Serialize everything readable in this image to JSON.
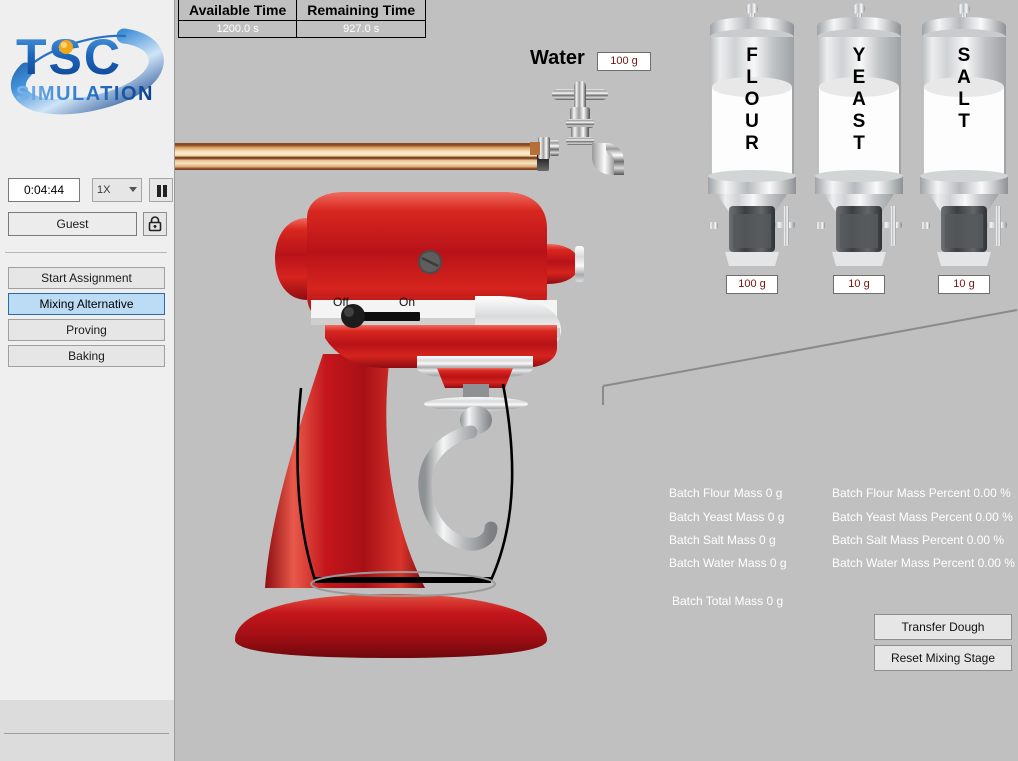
{
  "app": {
    "logo_main": "TSC",
    "logo_sub": "SIMULATION"
  },
  "sidebar": {
    "time_display": "0:04:44",
    "speed": "1X",
    "speed_options": [
      "1X"
    ],
    "pause_icon": "pause-icon",
    "user": "Guest",
    "lock_icon": "lock-icon",
    "nav": [
      {
        "label": "Start Assignment",
        "active": false
      },
      {
        "label": "Mixing Alternative",
        "active": true
      },
      {
        "label": "Proving",
        "active": false
      },
      {
        "label": "Baking",
        "active": false
      }
    ]
  },
  "time_table": {
    "headers": [
      "Available Time",
      "Remaining Time"
    ],
    "values": [
      "1200.0 s",
      "927.0 s"
    ]
  },
  "water": {
    "label": "Water",
    "value": "100 g",
    "faucet_icon": "faucet-icon",
    "pipe_icon": "copper-pipe"
  },
  "dispensers": [
    {
      "name": "FLOUR",
      "letters": [
        "F",
        "L",
        "O",
        "U",
        "R"
      ],
      "value": "100 g"
    },
    {
      "name": "YEAST",
      "letters": [
        "Y",
        "E",
        "A",
        "S",
        "T"
      ],
      "value": "10 g"
    },
    {
      "name": "SALT",
      "letters": [
        "S",
        "A",
        "L",
        "T"
      ],
      "value": "10 g"
    }
  ],
  "mixer": {
    "switch_off": "Off",
    "switch_on": "On",
    "switch_state": "Off"
  },
  "batch": {
    "mass": [
      "Batch Flour Mass 0 g",
      "Batch Yeast Mass 0 g",
      "Batch Salt Mass 0 g",
      "Batch Water Mass 0 g"
    ],
    "percent": [
      "Batch Flour Mass Percent 0.00 %",
      "Batch Yeast Mass Percent 0.00 %",
      "Batch Salt Mass Percent 0.00 %",
      "Batch Water Mass Percent 0.00 %"
    ],
    "total": "Batch Total Mass 0 g"
  },
  "actions": {
    "transfer": "Transfer Dough",
    "reset": "Reset Mixing Stage"
  },
  "colors": {
    "accent": "#bcdcf5",
    "accent_border": "#2a6ca8",
    "sidebar_bg": "#efefef",
    "canvas_bg": "#c0c0c0",
    "input_text": "#7a1410",
    "readout_text": "#ffffff",
    "mixer_red": "#c4161c"
  }
}
